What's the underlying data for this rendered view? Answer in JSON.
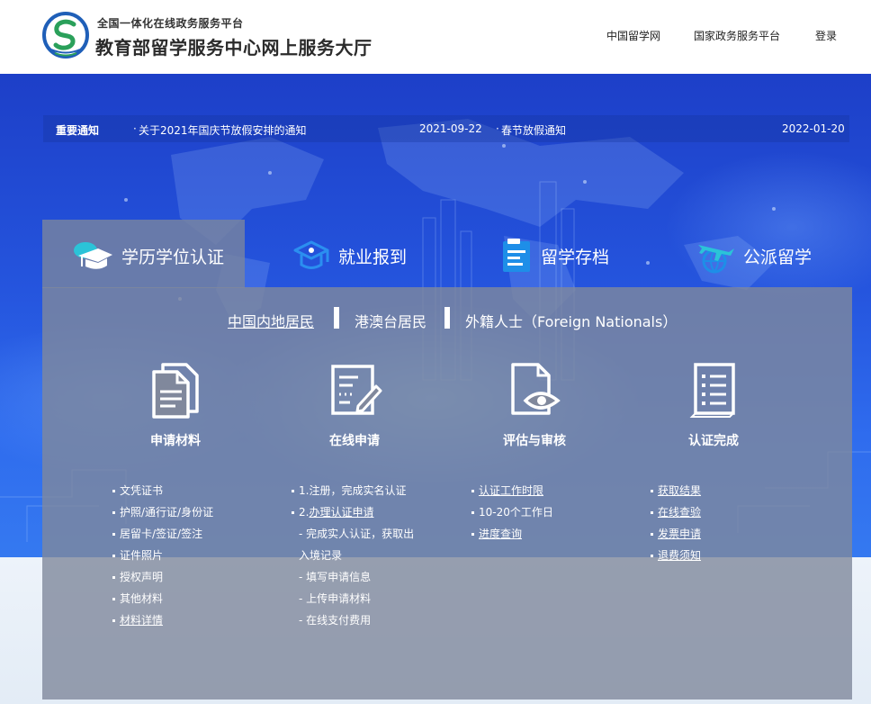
{
  "header": {
    "subtitle": "全国一体化在线政务服务平台",
    "title": "教育部留学服务中心网上服务大厅",
    "links": [
      "中国留学网",
      "国家政务服务平台",
      "登录"
    ]
  },
  "notices": {
    "label": "重要通知",
    "items": [
      {
        "title": "关于2021年国庆节放假安排的通知",
        "date": "2021-09-22"
      },
      {
        "title": "春节放假通知",
        "date": "2022-01-20"
      }
    ]
  },
  "service_tabs": [
    {
      "label": "学历学位认证",
      "icon": "graduation-cap-icon",
      "active": true
    },
    {
      "label": "就业报到",
      "icon": "employment-cap-icon",
      "active": false
    },
    {
      "label": "留学存档",
      "icon": "archive-document-icon",
      "active": false
    },
    {
      "label": "公派留学",
      "icon": "airplane-globe-icon",
      "active": false
    }
  ],
  "resident_tabs": [
    {
      "label": "中国内地居民",
      "active": true
    },
    {
      "label": "港澳台居民",
      "active": false
    },
    {
      "label": "外籍人士（Foreign Nationals）",
      "active": false
    }
  ],
  "steps": [
    {
      "title": "申请材料",
      "icon": "documents-icon",
      "items": [
        {
          "text": "文凭证书",
          "bullet": true,
          "link": false
        },
        {
          "text": "护照/通行证/身份证",
          "bullet": true,
          "link": false
        },
        {
          "text": "居留卡/签证/签注",
          "bullet": true,
          "link": false
        },
        {
          "text": "证件照片",
          "bullet": true,
          "link": false
        },
        {
          "text": "授权声明",
          "bullet": true,
          "link": false
        },
        {
          "text": "其他材料",
          "bullet": true,
          "link": false
        },
        {
          "text": "材料详情",
          "bullet": true,
          "link": true
        }
      ]
    },
    {
      "title": "在线申请",
      "icon": "online-form-icon",
      "items": [
        {
          "text": "1.注册，完成实名认证",
          "bullet": true,
          "link": false
        },
        {
          "prefix": "2.",
          "text": "办理认证申请",
          "bullet": true,
          "link": true
        },
        {
          "text": "- 完成实人认证，获取出",
          "bullet": false,
          "link": false
        },
        {
          "text": "入境记录",
          "bullet": false,
          "link": false
        },
        {
          "text": "- 填写申请信息",
          "bullet": false,
          "link": false
        },
        {
          "text": "- 上传申请材料",
          "bullet": false,
          "link": false
        },
        {
          "text": "- 在线支付费用",
          "bullet": false,
          "link": false
        }
      ]
    },
    {
      "title": "评估与审核",
      "icon": "document-review-eye-icon",
      "items": [
        {
          "text": "认证工作时限",
          "bullet": true,
          "link": true
        },
        {
          "text": "10-20个工作日",
          "bullet": true,
          "link": false
        },
        {
          "text": "进度查询",
          "bullet": true,
          "link": true
        }
      ]
    },
    {
      "title": "认证完成",
      "icon": "checklist-icon",
      "items": [
        {
          "text": "获取结果",
          "bullet": true,
          "link": true
        },
        {
          "text": "在线查验",
          "bullet": true,
          "link": true
        },
        {
          "text": "发票申请",
          "bullet": true,
          "link": true
        },
        {
          "text": "退费须知",
          "bullet": true,
          "link": true
        }
      ]
    }
  ],
  "colors": {
    "hero_blue": "#2555de",
    "panel_grey": "#80889c",
    "logo_blue": "#1f5fb8",
    "logo_green": "#2aa05a",
    "icon_cyan": "#2bc3d8",
    "icon_blue": "#1e8ee8"
  }
}
